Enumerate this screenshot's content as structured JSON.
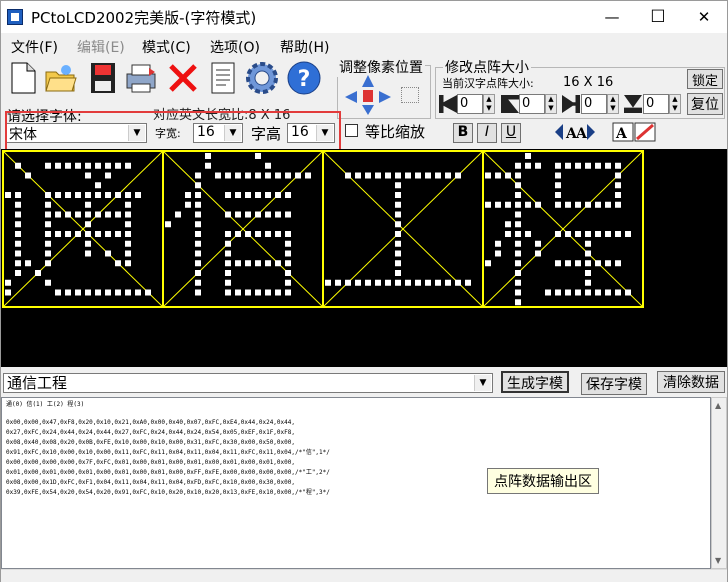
{
  "window": {
    "title": "PCtoLCD2002完美版-(字符模式)",
    "controls": {
      "minimize": "—",
      "maximize": "☐",
      "close": "✕"
    }
  },
  "menu": [
    {
      "label": "文件(F)",
      "enabled": true
    },
    {
      "label": "编辑(E)",
      "enabled": false
    },
    {
      "label": "模式(C)",
      "enabled": true
    },
    {
      "label": "选项(O)",
      "enabled": true
    },
    {
      "label": "帮助(H)",
      "enabled": true
    }
  ],
  "toolbar_icons": [
    "new-file-icon",
    "open-folder-icon",
    "save-disk-icon",
    "print-icon",
    "delete-x-icon",
    "notes-icon",
    "settings-gear-icon",
    "help-icon"
  ],
  "pixel_adjust": {
    "label": "调整像素位置"
  },
  "dot_matrix": {
    "label": "修改点阵大小",
    "current_label": "当前汉字点阵大小:",
    "current_value": "16 X 16",
    "lock_button": "锁定",
    "restore_button": "复位",
    "spinners": [
      "0",
      "0",
      "0",
      "0"
    ]
  },
  "font": {
    "prompt": "请选择字体:",
    "ascii_width_note": "对应英文长宽比:8 X 16",
    "selected": "宋体",
    "width_label": "字宽:",
    "width_value": "16",
    "height_label": "字高",
    "height_value": "16",
    "keep_ratio_label": "等比缩放",
    "bold": "B",
    "italic": "I",
    "underline": "U"
  },
  "preview": {
    "characters": [
      "通",
      "信",
      "工",
      "程"
    ],
    "grid_color": "#ffff00",
    "pixel_color": "#ffffff",
    "background": "#000000"
  },
  "input": {
    "text": "通信工程",
    "generate_button": "生成字模",
    "save_button": "保存字模",
    "clear_button": "清除数据"
  },
  "output": {
    "header": "通(0) 信(1) 工(2) 程(3)",
    "lines": [
      "0x00,0x00,0x47,0xF8,0x20,0x10,0x21,0xA0,0x00,0x40,0x07,0xFC,0xE4,0x44,0x24,0x44,",
      "0x27,0xFC,0x24,0x44,0x24,0x44,0x27,0xFC,0x24,0x44,0x24,0x54,0x05,0xEF,0x1F,0xF8,",
      "0x08,0x40,0x08,0x20,0x0B,0xFE,0x10,0x00,0x10,0x00,0x31,0xFC,0x30,0x00,0x50,0x00,",
      "0x91,0xFC,0x10,0x00,0x10,0x00,0x11,0xFC,0x11,0x04,0x11,0x04,0x11,0xFC,0x11,0x04,/*\"信\",1*/",
      "0x00,0x00,0x00,0x00,0x7F,0xFC,0x01,0x00,0x01,0x00,0x01,0x00,0x01,0x00,0x01,0x00,",
      "0x01,0x00,0x01,0x00,0x01,0x00,0x01,0x00,0x01,0x00,0xFF,0xFE,0x00,0x00,0x00,0x00,/*\"工\",2*/",
      "0x08,0x00,0x1D,0xFC,0xF1,0x04,0x11,0x04,0x11,0x04,0xFD,0xFC,0x10,0x00,0x30,0x00,",
      "0x39,0xFE,0x54,0x20,0x54,0x20,0x91,0xFC,0x10,0x20,0x10,0x20,0x13,0xFE,0x10,0x00,/*\"程\",3*/"
    ],
    "tooltip": "点阵数据输出区"
  }
}
